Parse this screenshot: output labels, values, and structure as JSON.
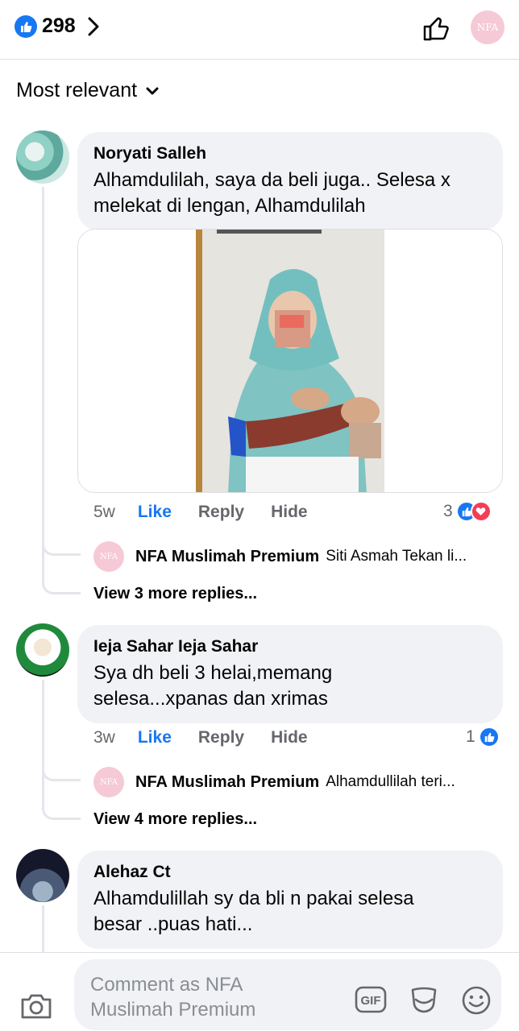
{
  "header": {
    "reaction_count": "298",
    "page_avatar_text": "NFA"
  },
  "sort": {
    "label": "Most relevant"
  },
  "comments": [
    {
      "author": "Noryati Salleh",
      "text": "Alhamdulilah,  saya da beli juga.. Selesa x melekat di lengan,   Alhamdulilah",
      "time": "5w",
      "like": "Like",
      "reply": "Reply",
      "hide": "Hide",
      "reactions": "3",
      "reply_author": "NFA Muslimah Premium",
      "reply_text": "Siti Asmah Tekan li...",
      "more_replies": "View 3 more replies..."
    },
    {
      "author": "Ieja Sahar Ieja Sahar",
      "text": "Sya dh beli 3 helai,memang selesa...xpanas dan xrimas",
      "time": "3w",
      "like": "Like",
      "reply": "Reply",
      "hide": "Hide",
      "reactions": "1",
      "reply_author": "NFA Muslimah Premium",
      "reply_text": "Alhamdullilah teri...",
      "more_replies": "View 4 more replies..."
    },
    {
      "author": "Alehaz Ct",
      "text": "Alhamdulillah sy da bli n pakai selesa besar ..puas hati..."
    }
  ],
  "composer": {
    "placeholder": "Comment as NFA Muslimah Premium",
    "gif_label": "GIF"
  },
  "icons": {
    "like_badge": "like-icon",
    "love_badge": "love-icon",
    "camera": "camera-icon",
    "sticker": "sticker-icon",
    "emoji": "emoji-icon"
  },
  "colors": {
    "accent": "#1877f2",
    "love": "#f33e58",
    "bubble": "#f0f2f5",
    "muted": "#65676b"
  }
}
